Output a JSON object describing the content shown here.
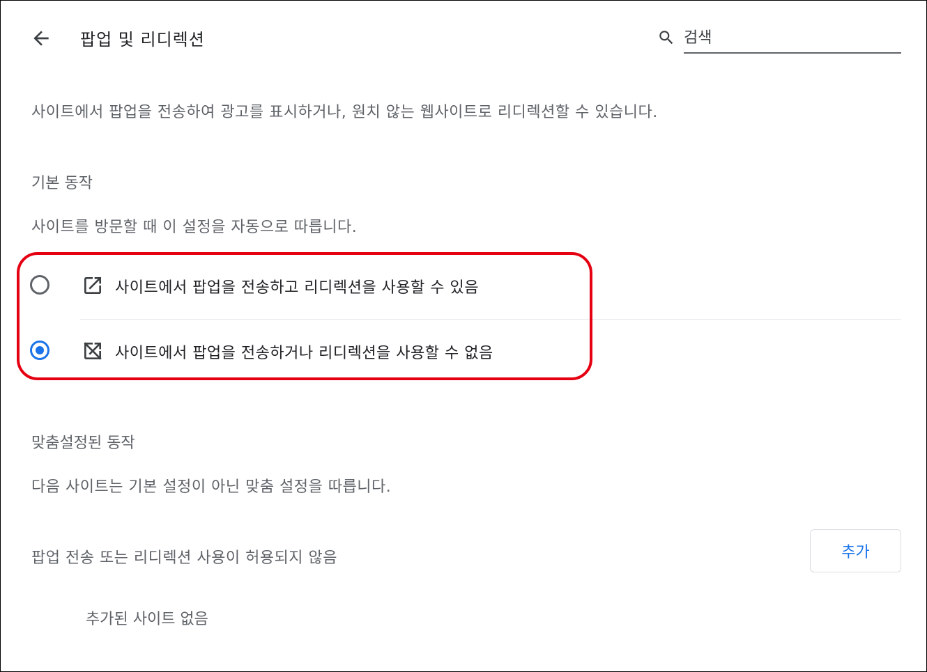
{
  "header": {
    "title": "팝업 및 리디렉션",
    "back_icon": "arrow-back-icon",
    "search": {
      "icon": "search-icon",
      "placeholder": "검색",
      "value": ""
    }
  },
  "description": "사이트에서 팝업을 전송하여 광고를 표시하거나, 원치 않는 웹사이트로 리디렉션할 수 있습니다.",
  "default_behavior": {
    "title": "기본 동작",
    "subtitle": "사이트를 방문할 때 이 설정을 자동으로 따릅니다.",
    "options": [
      {
        "label": "사이트에서 팝업을 전송하고 리디렉션을 사용할 수 있음",
        "icon": "open-in-new-icon",
        "checked": false
      },
      {
        "label": "사이트에서 팝업을 전송하거나 리디렉션을 사용할 수 없음",
        "icon": "open-in-new-off-icon",
        "checked": true
      }
    ]
  },
  "custom_behavior": {
    "title": "맞춤설정된 동작",
    "subtitle": "다음 사이트는 기본 설정이 아닌 맞춤 설정을 따릅니다.",
    "blocked_list": {
      "title": "팝업 전송 또는 리디렉션 사용이 허용되지 않음",
      "add_button": "추가",
      "empty_text": "추가된 사이트 없음"
    }
  },
  "colors": {
    "accent": "#1a73e8",
    "highlight": "#e50012",
    "text_primary": "#202124",
    "text_secondary": "#5f6368"
  }
}
